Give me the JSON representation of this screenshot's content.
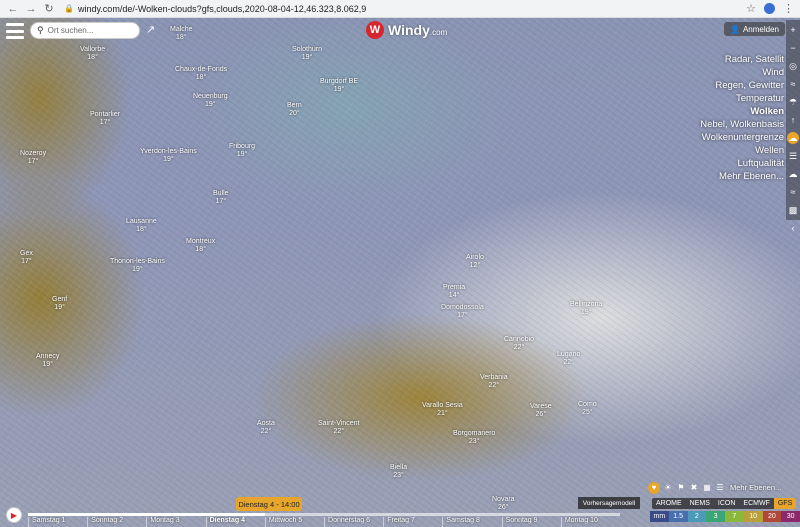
{
  "browser": {
    "url": "windy.com/de/-Wolken-clouds?gfs,clouds,2020-08-04-12,46.323,8.062,9",
    "icons": [
      "back-icon",
      "forward-icon",
      "reload-icon",
      "lock-icon",
      "star-icon",
      "profile-icon",
      "menu-dots-icon"
    ]
  },
  "header": {
    "search_placeholder": "Ort suchen...",
    "logo_text": "Windy",
    "logo_suffix": ".com",
    "login_label": "Anmelden"
  },
  "layers": [
    {
      "label": "Radar, Satellit",
      "active": false
    },
    {
      "label": "Wind",
      "active": false
    },
    {
      "label": "Regen, Gewitter",
      "active": false
    },
    {
      "label": "Temperatur",
      "active": false
    },
    {
      "label": "Wolken",
      "active": true
    },
    {
      "label": "Nebel, Wolkenbasis",
      "active": false
    },
    {
      "label": "Wolkenuntergrenze",
      "active": false
    },
    {
      "label": "Wellen",
      "active": false
    },
    {
      "label": "Luftqualität",
      "active": false
    },
    {
      "label": "Mehr Ebenen...",
      "active": false
    }
  ],
  "cities": [
    {
      "name": "Malche",
      "temp": "18°"
    },
    {
      "name": "Vallorbe",
      "temp": "18°"
    },
    {
      "name": "Chaux-de-Fonds",
      "temp": "18°"
    },
    {
      "name": "Solothurn",
      "temp": "19°"
    },
    {
      "name": "Neuenburg",
      "temp": "19°"
    },
    {
      "name": "Burgdorf BE",
      "temp": "19°"
    },
    {
      "name": "Pontarlier",
      "temp": "17°"
    },
    {
      "name": "Bern",
      "temp": "20°"
    },
    {
      "name": "Yverdon-les-Bains",
      "temp": "19°"
    },
    {
      "name": "Fribourg",
      "temp": "19°"
    },
    {
      "name": "Nozeroy",
      "temp": "17°"
    },
    {
      "name": "Bulle",
      "temp": "17°"
    },
    {
      "name": "Lausanne",
      "temp": "18°"
    },
    {
      "name": "Montreux",
      "temp": "18°"
    },
    {
      "name": "Thonon-les-Bains",
      "temp": "19°"
    },
    {
      "name": "Gex",
      "temp": "17°"
    },
    {
      "name": "Genf",
      "temp": "19°"
    },
    {
      "name": "Annecy",
      "temp": "19°"
    },
    {
      "name": "Aosta",
      "temp": "22°"
    },
    {
      "name": "Saint-Vincent",
      "temp": "22°"
    },
    {
      "name": "Domodossola",
      "temp": "17°"
    },
    {
      "name": "Cannobio",
      "temp": "22°"
    },
    {
      "name": "Bellinzona",
      "temp": "19°"
    },
    {
      "name": "Lugano",
      "temp": "22°"
    },
    {
      "name": "Verbania",
      "temp": "22°"
    },
    {
      "name": "Varallo Sesia",
      "temp": "21°"
    },
    {
      "name": "Borgomanero",
      "temp": "23°"
    },
    {
      "name": "Varese",
      "temp": "26°"
    },
    {
      "name": "Como",
      "temp": "25°"
    },
    {
      "name": "Biella",
      "temp": "23°"
    },
    {
      "name": "Novara",
      "temp": "26°"
    },
    {
      "name": "Airolo",
      "temp": "12°"
    },
    {
      "name": "Premia",
      "temp": "14°"
    }
  ],
  "timeline": {
    "current": "Dienstag 4 - 14:00",
    "days": [
      "Samstag 1",
      "Sonntag 2",
      "Montag 3",
      "Dienstag 4",
      "Mittwoch 5",
      "Donnerstag 6",
      "Freitag 7",
      "Samstag 8",
      "Sonntag 9",
      "Montag 10"
    ],
    "active_day_index": 3,
    "progress": 0.4
  },
  "model_panel": {
    "title": "Vorhersagemodell",
    "more_layers": "Mehr Ebenen...",
    "models": [
      "AROME",
      "NEMS",
      "ICON",
      "ECMWF",
      "GFS"
    ],
    "selected_model": "GFS"
  },
  "legend": {
    "unit": "mm",
    "values": [
      "1.5",
      "2",
      "3",
      "7",
      "10",
      "20",
      "30"
    ]
  },
  "colors": {
    "accent": "#e8a52b",
    "brand": "#d6262e"
  }
}
